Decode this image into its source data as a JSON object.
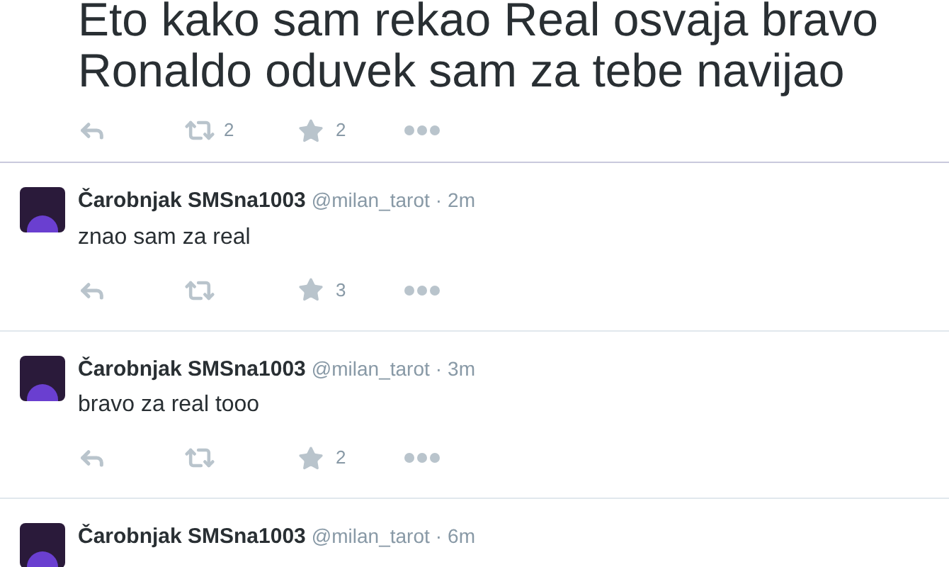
{
  "main_tweet": {
    "text": "Eto kako sam rekao Real osvaja bravo Ronaldo oduvek sam za tebe navijao",
    "retweets": "2",
    "favorites": "2"
  },
  "replies": [
    {
      "name": "Čarobnjak SMSna1003",
      "handle": "@milan_tarot",
      "separator": "·",
      "time": "2m",
      "text": "znao sam za real",
      "favorites": "3"
    },
    {
      "name": "Čarobnjak SMSna1003",
      "handle": "@milan_tarot",
      "separator": "·",
      "time": "3m",
      "text": "bravo za real tooo",
      "favorites": "2"
    },
    {
      "name": "Čarobnjak SMSna1003",
      "handle": "@milan_tarot",
      "separator": "·",
      "time": "6m"
    }
  ]
}
